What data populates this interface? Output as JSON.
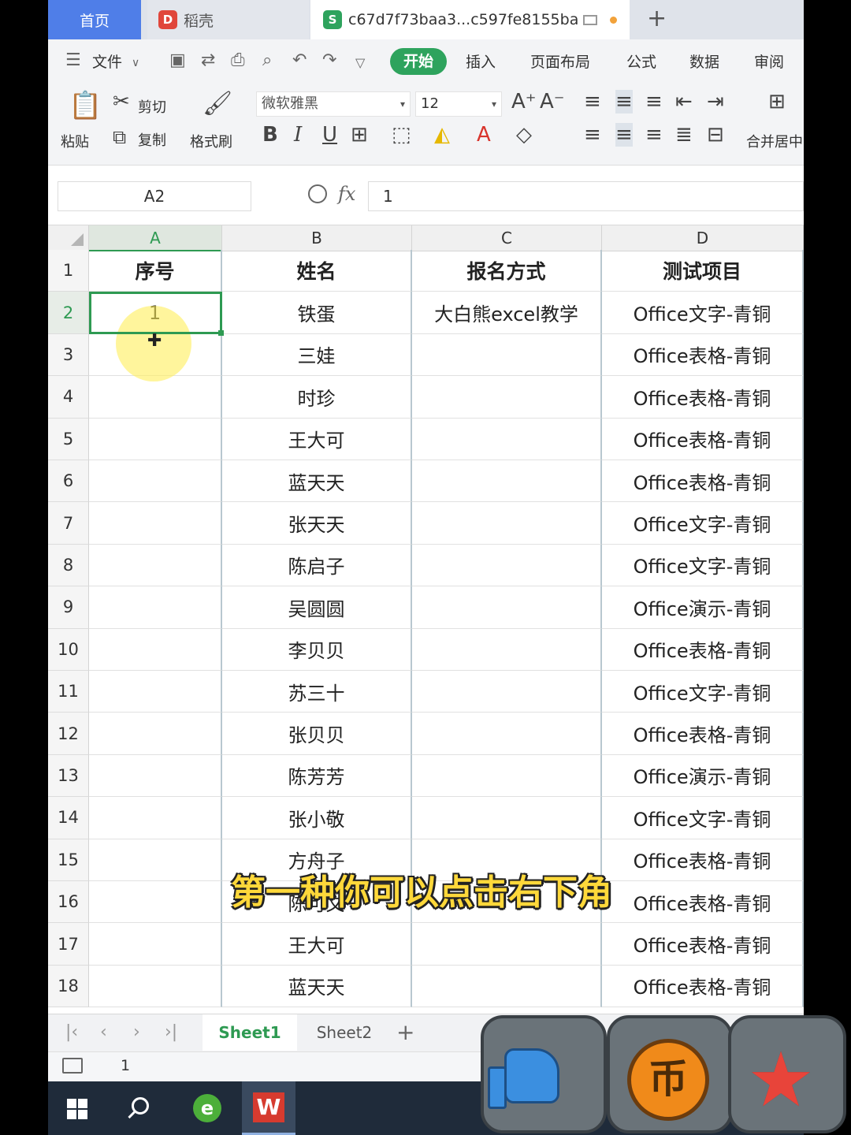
{
  "tabs": {
    "home": "首页",
    "daoke": "稻壳",
    "document": "c67d7f73baa3...c597fe8155ba",
    "add": "+"
  },
  "menu": {
    "file": "文件",
    "start": "开始",
    "insert": "插入",
    "page_layout": "页面布局",
    "formula": "公式",
    "data": "数据",
    "review": "审阅"
  },
  "ribbon": {
    "paste": "粘贴",
    "cut": "剪切",
    "copy": "复制",
    "format_painter": "格式刷",
    "font_name": "微软雅黑",
    "font_size": "12",
    "merge_center": "合并居中"
  },
  "formula_bar": {
    "cell_ref": "A2",
    "fx": "fx",
    "value": "1"
  },
  "columns": [
    "A",
    "B",
    "C",
    "D"
  ],
  "rows": [
    {
      "n": "1",
      "a": "序号",
      "b": "姓名",
      "c": "报名方式",
      "d": "测试项目"
    },
    {
      "n": "2",
      "a": "1",
      "b": "铁蛋",
      "c": "大白熊excel教学",
      "d": "Office文字-青铜"
    },
    {
      "n": "3",
      "a": "",
      "b": "三娃",
      "c": "",
      "d": "Office表格-青铜"
    },
    {
      "n": "4",
      "a": "",
      "b": "时珍",
      "c": "",
      "d": "Office表格-青铜"
    },
    {
      "n": "5",
      "a": "",
      "b": "王大可",
      "c": "",
      "d": "Office表格-青铜"
    },
    {
      "n": "6",
      "a": "",
      "b": "蓝天天",
      "c": "",
      "d": "Office表格-青铜"
    },
    {
      "n": "7",
      "a": "",
      "b": "张天天",
      "c": "",
      "d": "Office文字-青铜"
    },
    {
      "n": "8",
      "a": "",
      "b": "陈启子",
      "c": "",
      "d": "Office文字-青铜"
    },
    {
      "n": "9",
      "a": "",
      "b": "吴圆圆",
      "c": "",
      "d": "Office演示-青铜"
    },
    {
      "n": "10",
      "a": "",
      "b": "李贝贝",
      "c": "",
      "d": "Office表格-青铜"
    },
    {
      "n": "11",
      "a": "",
      "b": "苏三十",
      "c": "",
      "d": "Office文字-青铜"
    },
    {
      "n": "12",
      "a": "",
      "b": "张贝贝",
      "c": "",
      "d": "Office表格-青铜"
    },
    {
      "n": "13",
      "a": "",
      "b": "陈芳芳",
      "c": "",
      "d": "Office演示-青铜"
    },
    {
      "n": "14",
      "a": "",
      "b": "张小敬",
      "c": "",
      "d": "Office文字-青铜"
    },
    {
      "n": "15",
      "a": "",
      "b": "方舟子",
      "c": "",
      "d": "Office表格-青铜"
    },
    {
      "n": "16",
      "a": "",
      "b": "陈可文",
      "c": "",
      "d": "Office表格-青铜"
    },
    {
      "n": "17",
      "a": "",
      "b": "王大可",
      "c": "",
      "d": "Office表格-青铜"
    },
    {
      "n": "18",
      "a": "",
      "b": "蓝天天",
      "c": "",
      "d": "Office表格-青铜"
    }
  ],
  "sheets": [
    "Sheet1",
    "Sheet2"
  ],
  "status": {
    "value": "1"
  },
  "subtitle": "第一种你可以点击右下角",
  "colors": {
    "accent_green": "#2e9a52",
    "home_tab_blue": "#4f7ee8",
    "subtitle_yellow": "#ffd83a"
  },
  "icons": [
    "like-icon",
    "coin-icon",
    "favorite-star-icon",
    "windows-start-icon",
    "search-icon",
    "browser-icon",
    "wps-office-icon"
  ]
}
